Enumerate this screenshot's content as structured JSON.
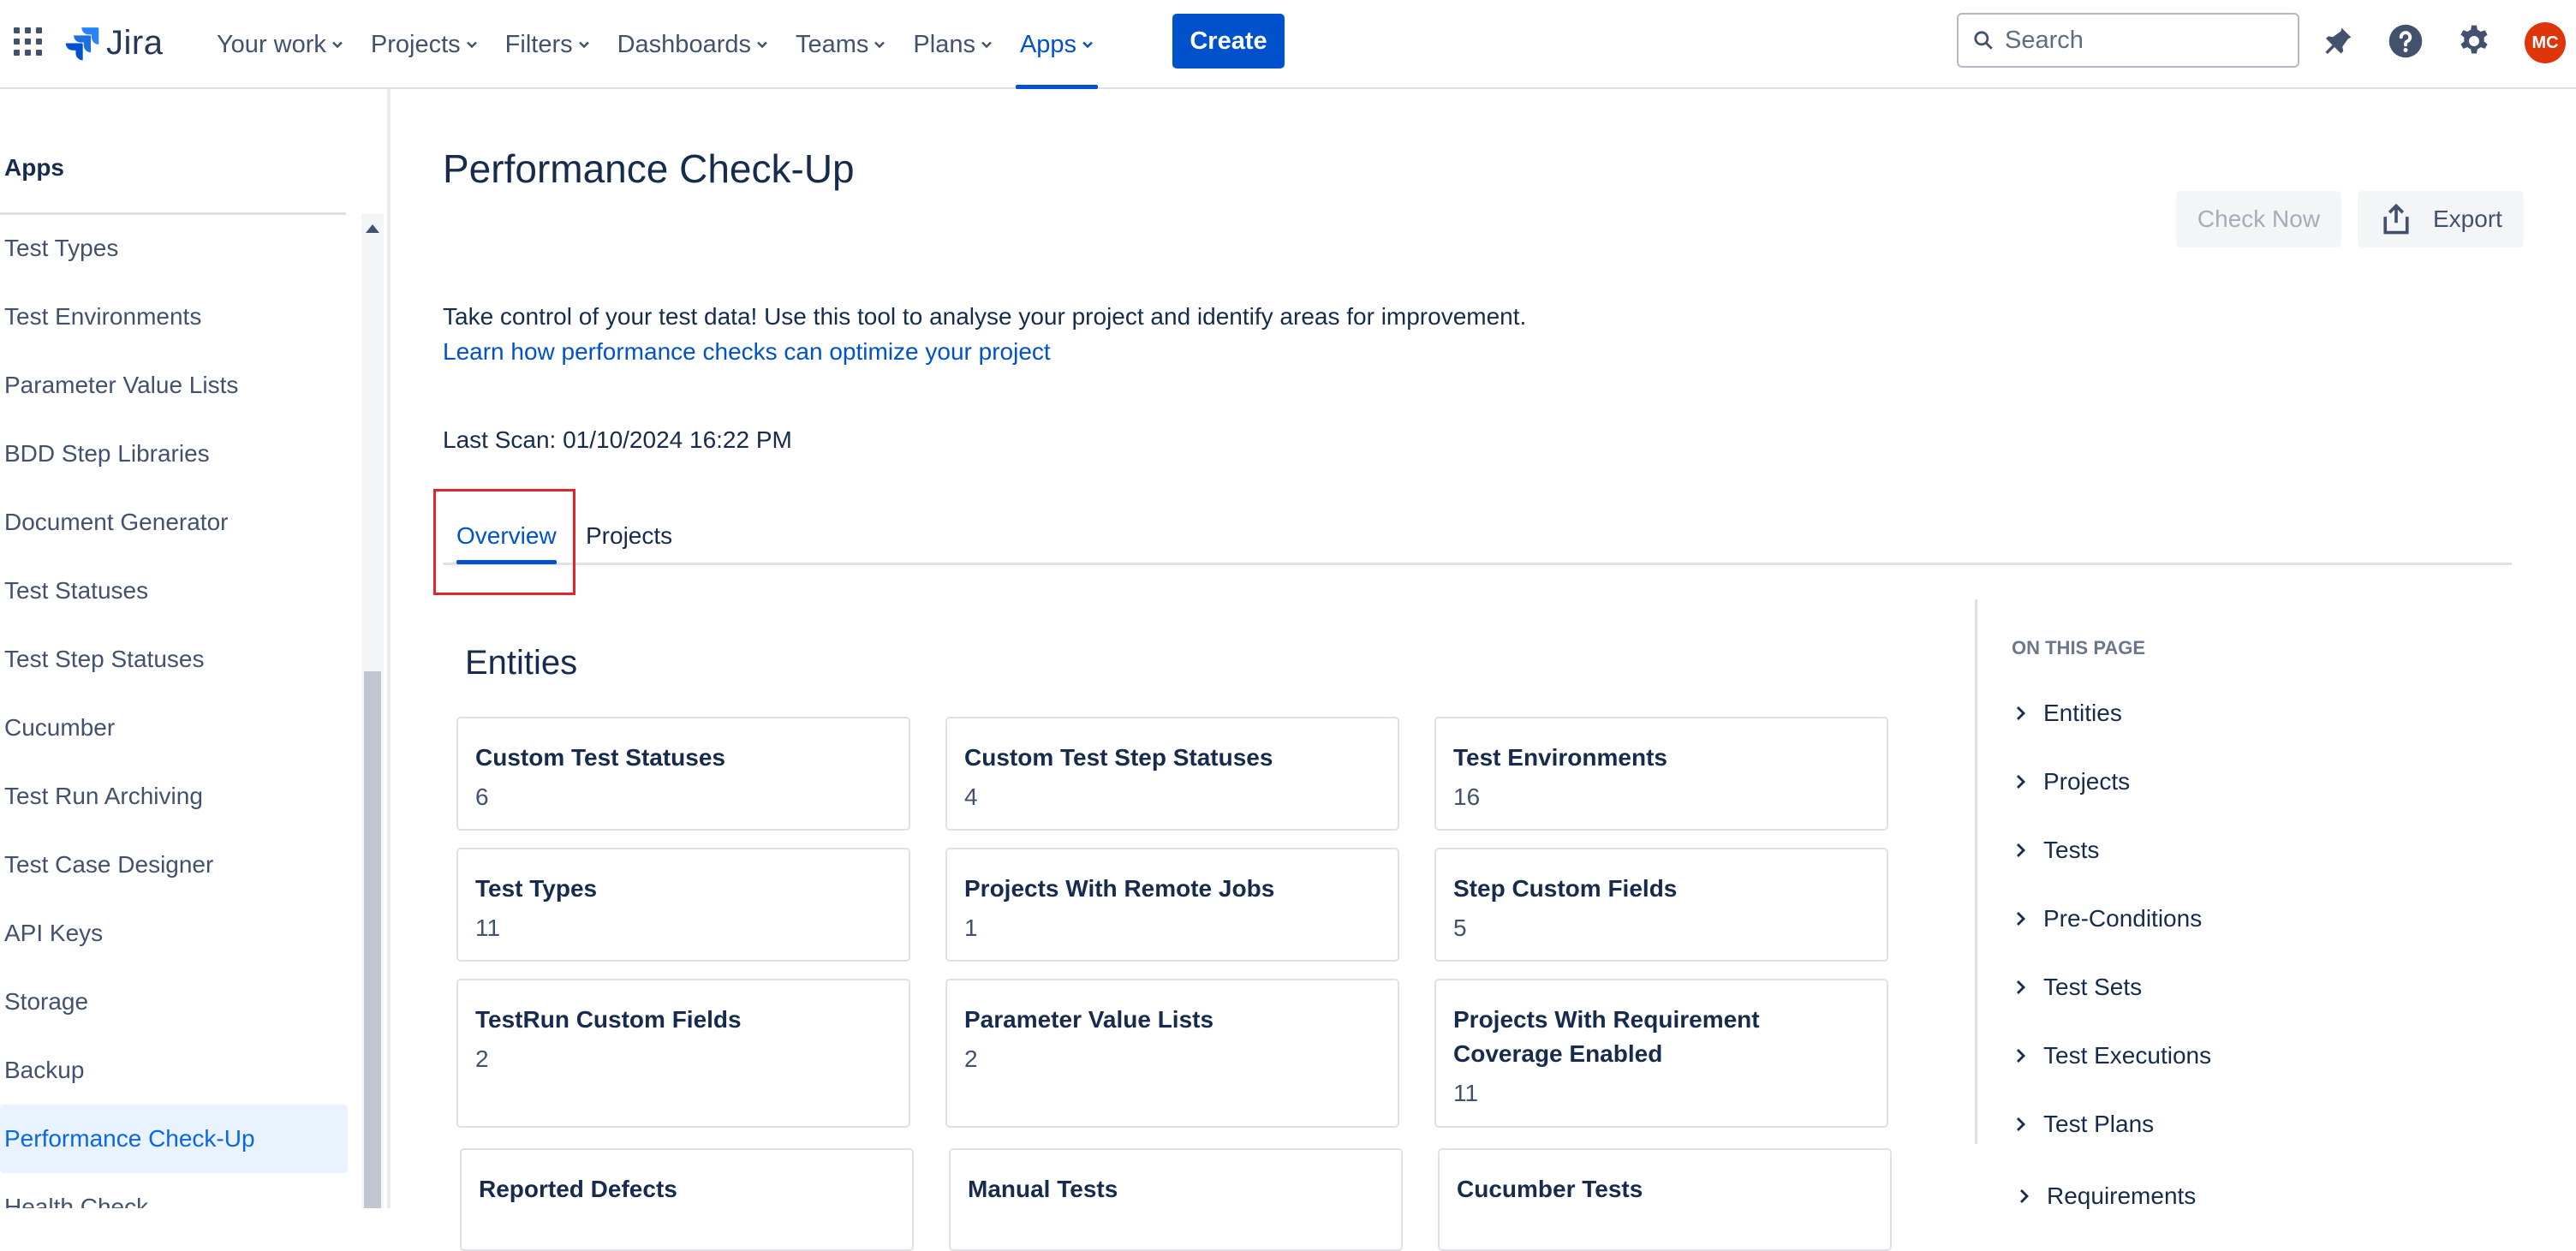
{
  "nav": {
    "logo_text": "Jira",
    "items": [
      {
        "label": "Your work"
      },
      {
        "label": "Projects"
      },
      {
        "label": "Filters"
      },
      {
        "label": "Dashboards"
      },
      {
        "label": "Teams"
      },
      {
        "label": "Plans"
      },
      {
        "label": "Apps",
        "active": true
      }
    ],
    "create_label": "Create",
    "search_placeholder": "Search",
    "avatar_initials": "MC"
  },
  "sidebar": {
    "heading": "Apps",
    "items": [
      "Test Types",
      "Test Environments",
      "Parameter Value Lists",
      "BDD Step Libraries",
      "Document Generator",
      "Test Statuses",
      "Test Step Statuses",
      "Cucumber",
      "Test Run Archiving",
      "Test Case Designer",
      "API Keys",
      "Storage",
      "Backup",
      "Performance Check-Up",
      "Health Check"
    ],
    "selected": "Performance Check-Up"
  },
  "main": {
    "title": "Performance Check-Up",
    "check_now_label": "Check Now",
    "export_label": "Export",
    "intro": "Take control of your test data! Use this tool to analyse your project and identify areas for improvement.",
    "learn_link": "Learn how performance checks can optimize your project",
    "last_scan": "Last Scan: 01/10/2024 16:22 PM",
    "tabs": [
      "Overview",
      "Projects"
    ],
    "active_tab": "Overview",
    "entities_title": "Entities",
    "cards": [
      {
        "title": "Custom Test Statuses",
        "value": "6"
      },
      {
        "title": "Custom Test Step Statuses",
        "value": "4"
      },
      {
        "title": "Test Environments",
        "value": "16"
      },
      {
        "title": "Test Types",
        "value": "11"
      },
      {
        "title": "Projects With Remote Jobs",
        "value": "1"
      },
      {
        "title": "Step Custom Fields",
        "value": "5"
      },
      {
        "title": "TestRun Custom Fields",
        "value": "2"
      },
      {
        "title": "Parameter Value Lists",
        "value": "2"
      },
      {
        "title": "Projects With Requirement Coverage Enabled",
        "value": "11"
      },
      {
        "title": "Reported Defects",
        "value": ""
      },
      {
        "title": "Manual Tests",
        "value": ""
      },
      {
        "title": "Cucumber Tests",
        "value": ""
      }
    ]
  },
  "toc": {
    "heading": "ON THIS PAGE",
    "items": [
      "Entities",
      "Projects",
      "Tests",
      "Pre-Conditions",
      "Test Sets",
      "Test Executions",
      "Test Plans",
      "Requirements"
    ]
  },
  "colors": {
    "brand": "#0052cc",
    "highlight": "#e3242b",
    "avatar": "#de350b",
    "selected_bg": "#e9f2ff"
  }
}
